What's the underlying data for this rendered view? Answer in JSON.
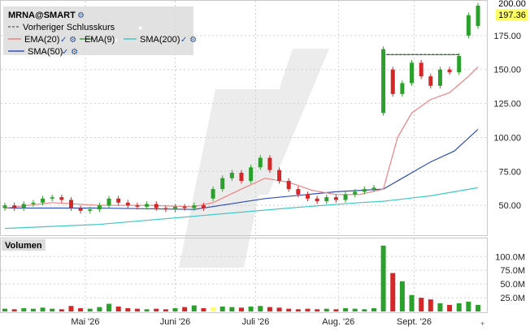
{
  "legend": {
    "symbol": "MRNA@SMART",
    "prev_close": "Vorheriger Schlusskurs",
    "ema20": "EMA(20)",
    "ema9": "EMA(9)",
    "sma200": "SMA(200)",
    "sma50": "SMA(50)"
  },
  "volume_label": "Volumen",
  "colors": {
    "up": "#2ca02c",
    "down": "#d62728",
    "ema20": "#f08080",
    "ema9": "#40a040",
    "sma200": "#40c8c8",
    "sma50": "#3050b8",
    "last_price": "#ffff66",
    "volume_up": "#2ca02c",
    "volume_down": "#d62728",
    "volume_highlight": "#ffff66"
  },
  "chart_data": {
    "type": "candlestick",
    "title": "MRNA@SMART",
    "price_axis": {
      "ticks": [
        50,
        75,
        100,
        125,
        150,
        175
      ],
      "ylim": [
        28,
        200
      ]
    },
    "volume_axis": {
      "ticks": [
        25,
        50,
        75,
        100
      ],
      "unit": "M",
      "tick_labels": [
        "25.0M",
        "50.0M",
        "75.0M",
        "100.0M"
      ],
      "ylim": [
        0,
        130
      ]
    },
    "x_labels": [
      "Mai '26",
      "Juni '26",
      "Juli '26",
      "Aug. '26",
      "Sept. '26"
    ],
    "last_price": 197.36,
    "last_price_label": "197.36",
    "prev_close_level": 161,
    "prev_close_range": [
      0.808,
      0.962
    ],
    "candles": [
      {
        "p": 0.0,
        "o": 48,
        "c": 50
      },
      {
        "p": 0.02,
        "o": 50,
        "c": 48
      },
      {
        "p": 0.04,
        "o": 48,
        "c": 51
      },
      {
        "p": 0.06,
        "o": 51,
        "c": 52
      },
      {
        "p": 0.08,
        "o": 52,
        "c": 55
      },
      {
        "p": 0.1,
        "o": 55,
        "c": 56
      },
      {
        "p": 0.12,
        "o": 56,
        "c": 54
      },
      {
        "p": 0.14,
        "o": 54,
        "c": 48
      },
      {
        "p": 0.16,
        "o": 48,
        "c": 46
      },
      {
        "p": 0.18,
        "o": 46,
        "c": 47
      },
      {
        "p": 0.2,
        "o": 47,
        "c": 50
      },
      {
        "p": 0.22,
        "o": 50,
        "c": 55
      },
      {
        "p": 0.24,
        "o": 55,
        "c": 52
      },
      {
        "p": 0.26,
        "o": 52,
        "c": 50
      },
      {
        "p": 0.28,
        "o": 50,
        "c": 49
      },
      {
        "p": 0.3,
        "o": 49,
        "c": 51
      },
      {
        "p": 0.32,
        "o": 51,
        "c": 48
      },
      {
        "p": 0.34,
        "o": 48,
        "c": 47
      },
      {
        "p": 0.36,
        "o": 47,
        "c": 49
      },
      {
        "p": 0.38,
        "o": 49,
        "c": 48
      },
      {
        "p": 0.4,
        "o": 48,
        "c": 50
      },
      {
        "p": 0.42,
        "o": 50,
        "c": 48
      },
      {
        "p": 0.44,
        "o": 55,
        "c": 62
      },
      {
        "p": 0.46,
        "o": 62,
        "c": 70
      },
      {
        "p": 0.48,
        "o": 70,
        "c": 74
      },
      {
        "p": 0.5,
        "o": 74,
        "c": 68
      },
      {
        "p": 0.52,
        "o": 68,
        "c": 78
      },
      {
        "p": 0.54,
        "o": 78,
        "c": 85
      },
      {
        "p": 0.56,
        "o": 85,
        "c": 76
      },
      {
        "p": 0.58,
        "o": 76,
        "c": 68
      },
      {
        "p": 0.6,
        "o": 68,
        "c": 62
      },
      {
        "p": 0.62,
        "o": 62,
        "c": 58
      },
      {
        "p": 0.64,
        "o": 58,
        "c": 55
      },
      {
        "p": 0.66,
        "o": 55,
        "c": 53
      },
      {
        "p": 0.68,
        "o": 53,
        "c": 56
      },
      {
        "p": 0.7,
        "o": 56,
        "c": 54
      },
      {
        "p": 0.72,
        "o": 54,
        "c": 58
      },
      {
        "p": 0.74,
        "o": 58,
        "c": 60
      },
      {
        "p": 0.76,
        "o": 60,
        "c": 62
      },
      {
        "p": 0.78,
        "o": 62,
        "c": 63
      },
      {
        "p": 0.8,
        "o": 118,
        "c": 165
      },
      {
        "p": 0.82,
        "o": 150,
        "c": 132
      },
      {
        "p": 0.84,
        "o": 132,
        "c": 140
      },
      {
        "p": 0.86,
        "o": 140,
        "c": 155
      },
      {
        "p": 0.88,
        "o": 155,
        "c": 145
      },
      {
        "p": 0.9,
        "o": 145,
        "c": 138
      },
      {
        "p": 0.92,
        "o": 138,
        "c": 150
      },
      {
        "p": 0.94,
        "o": 150,
        "c": 148
      },
      {
        "p": 0.96,
        "o": 148,
        "c": 160
      },
      {
        "p": 0.98,
        "o": 175,
        "c": 190
      },
      {
        "p": 1.0,
        "o": 182,
        "c": 197
      }
    ],
    "volume": [
      {
        "p": 0.0,
        "v": 5
      },
      {
        "p": 0.02,
        "v": 4
      },
      {
        "p": 0.04,
        "v": 6
      },
      {
        "p": 0.06,
        "v": 5
      },
      {
        "p": 0.08,
        "v": 7
      },
      {
        "p": 0.1,
        "v": 5
      },
      {
        "p": 0.12,
        "v": 4
      },
      {
        "p": 0.14,
        "v": 10
      },
      {
        "p": 0.16,
        "v": 6
      },
      {
        "p": 0.18,
        "v": 5
      },
      {
        "p": 0.2,
        "v": 8
      },
      {
        "p": 0.22,
        "v": 14
      },
      {
        "p": 0.24,
        "v": 9
      },
      {
        "p": 0.26,
        "v": 6
      },
      {
        "p": 0.28,
        "v": 5
      },
      {
        "p": 0.3,
        "v": 4
      },
      {
        "p": 0.32,
        "v": 5
      },
      {
        "p": 0.34,
        "v": 4
      },
      {
        "p": 0.36,
        "v": 6
      },
      {
        "p": 0.38,
        "v": 8
      },
      {
        "p": 0.4,
        "v": 11
      },
      {
        "p": 0.42,
        "v": 6
      },
      {
        "p": 0.44,
        "v": 8
      },
      {
        "p": 0.46,
        "v": 9
      },
      {
        "p": 0.48,
        "v": 8
      },
      {
        "p": 0.5,
        "v": 7
      },
      {
        "p": 0.52,
        "v": 9
      },
      {
        "p": 0.54,
        "v": 10
      },
      {
        "p": 0.56,
        "v": 8
      },
      {
        "p": 0.58,
        "v": 7
      },
      {
        "p": 0.6,
        "v": 5
      },
      {
        "p": 0.62,
        "v": 4
      },
      {
        "p": 0.64,
        "v": 5
      },
      {
        "p": 0.66,
        "v": 4
      },
      {
        "p": 0.68,
        "v": 5
      },
      {
        "p": 0.7,
        "v": 4
      },
      {
        "p": 0.72,
        "v": 6
      },
      {
        "p": 0.74,
        "v": 5
      },
      {
        "p": 0.76,
        "v": 4
      },
      {
        "p": 0.78,
        "v": 6
      },
      {
        "p": 0.8,
        "v": 120
      },
      {
        "p": 0.82,
        "v": 70
      },
      {
        "p": 0.84,
        "v": 55
      },
      {
        "p": 0.86,
        "v": 30
      },
      {
        "p": 0.88,
        "v": 25
      },
      {
        "p": 0.9,
        "v": 22
      },
      {
        "p": 0.92,
        "v": 15
      },
      {
        "p": 0.94,
        "v": 12
      },
      {
        "p": 0.96,
        "v": 15
      },
      {
        "p": 0.98,
        "v": 18
      },
      {
        "p": 1.0,
        "v": 12
      }
    ],
    "ema20": [
      [
        0.0,
        48
      ],
      [
        0.1,
        52
      ],
      [
        0.2,
        50
      ],
      [
        0.3,
        50
      ],
      [
        0.4,
        49
      ],
      [
        0.44,
        52
      ],
      [
        0.5,
        62
      ],
      [
        0.55,
        70
      ],
      [
        0.6,
        67
      ],
      [
        0.65,
        61
      ],
      [
        0.7,
        58
      ],
      [
        0.75,
        58
      ],
      [
        0.8,
        62
      ],
      [
        0.83,
        100
      ],
      [
        0.86,
        118
      ],
      [
        0.9,
        128
      ],
      [
        0.94,
        133
      ],
      [
        0.98,
        145
      ],
      [
        1.0,
        152
      ]
    ],
    "ema9": [
      [
        0.805,
        161
      ],
      [
        0.96,
        161
      ]
    ],
    "sma200": [
      [
        0.0,
        33
      ],
      [
        0.2,
        36
      ],
      [
        0.4,
        42
      ],
      [
        0.6,
        48
      ],
      [
        0.75,
        52
      ],
      [
        0.8,
        53
      ],
      [
        0.9,
        57
      ],
      [
        1.0,
        63
      ]
    ],
    "sma50": [
      [
        0.0,
        48
      ],
      [
        0.2,
        48
      ],
      [
        0.4,
        47
      ],
      [
        0.55,
        55
      ],
      [
        0.7,
        60
      ],
      [
        0.8,
        62
      ],
      [
        0.85,
        72
      ],
      [
        0.9,
        82
      ],
      [
        0.95,
        90
      ],
      [
        1.0,
        106
      ]
    ]
  }
}
